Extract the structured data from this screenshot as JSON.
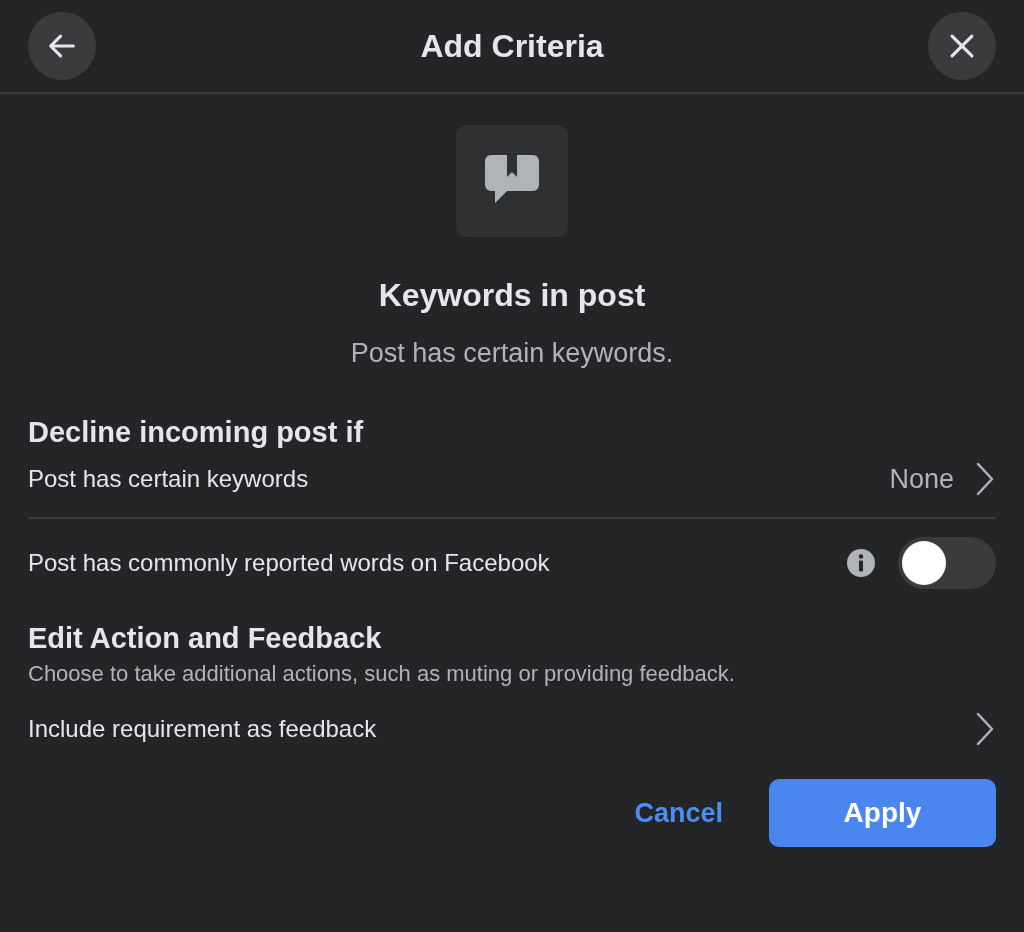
{
  "header": {
    "title": "Add Criteria"
  },
  "criterion": {
    "title": "Keywords in post",
    "description": "Post has certain keywords."
  },
  "decline_section": {
    "heading": "Decline incoming post if",
    "rows": [
      {
        "kind": "link",
        "label": "Post has certain keywords",
        "value": "None"
      },
      {
        "kind": "toggle",
        "label": "Post has commonly reported words on Facebook",
        "on": false
      }
    ]
  },
  "action_section": {
    "heading": "Edit Action and Feedback",
    "description": "Choose to take additional actions, such as muting or providing feedback.",
    "rows": [
      {
        "kind": "link",
        "label": "Include requirement as feedback"
      }
    ]
  },
  "buttons": {
    "cancel": "Cancel",
    "apply": "Apply"
  }
}
